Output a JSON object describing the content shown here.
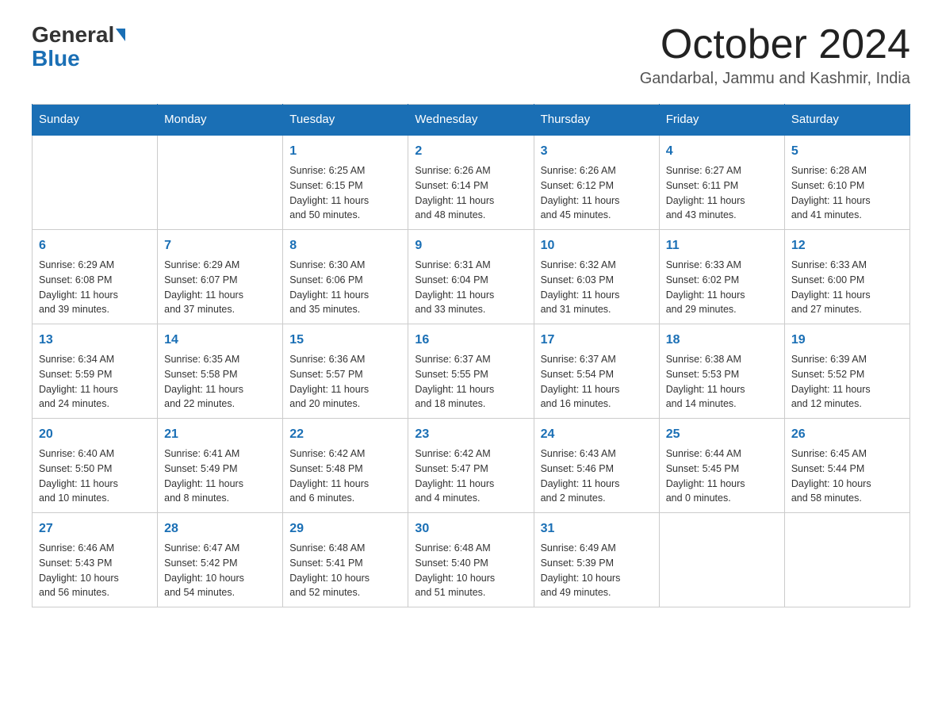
{
  "header": {
    "logo_general": "General",
    "logo_blue": "Blue",
    "month": "October 2024",
    "location": "Gandarbal, Jammu and Kashmir, India"
  },
  "days_of_week": [
    "Sunday",
    "Monday",
    "Tuesday",
    "Wednesday",
    "Thursday",
    "Friday",
    "Saturday"
  ],
  "weeks": [
    [
      {
        "day": "",
        "info": ""
      },
      {
        "day": "",
        "info": ""
      },
      {
        "day": "1",
        "info": "Sunrise: 6:25 AM\nSunset: 6:15 PM\nDaylight: 11 hours\nand 50 minutes."
      },
      {
        "day": "2",
        "info": "Sunrise: 6:26 AM\nSunset: 6:14 PM\nDaylight: 11 hours\nand 48 minutes."
      },
      {
        "day": "3",
        "info": "Sunrise: 6:26 AM\nSunset: 6:12 PM\nDaylight: 11 hours\nand 45 minutes."
      },
      {
        "day": "4",
        "info": "Sunrise: 6:27 AM\nSunset: 6:11 PM\nDaylight: 11 hours\nand 43 minutes."
      },
      {
        "day": "5",
        "info": "Sunrise: 6:28 AM\nSunset: 6:10 PM\nDaylight: 11 hours\nand 41 minutes."
      }
    ],
    [
      {
        "day": "6",
        "info": "Sunrise: 6:29 AM\nSunset: 6:08 PM\nDaylight: 11 hours\nand 39 minutes."
      },
      {
        "day": "7",
        "info": "Sunrise: 6:29 AM\nSunset: 6:07 PM\nDaylight: 11 hours\nand 37 minutes."
      },
      {
        "day": "8",
        "info": "Sunrise: 6:30 AM\nSunset: 6:06 PM\nDaylight: 11 hours\nand 35 minutes."
      },
      {
        "day": "9",
        "info": "Sunrise: 6:31 AM\nSunset: 6:04 PM\nDaylight: 11 hours\nand 33 minutes."
      },
      {
        "day": "10",
        "info": "Sunrise: 6:32 AM\nSunset: 6:03 PM\nDaylight: 11 hours\nand 31 minutes."
      },
      {
        "day": "11",
        "info": "Sunrise: 6:33 AM\nSunset: 6:02 PM\nDaylight: 11 hours\nand 29 minutes."
      },
      {
        "day": "12",
        "info": "Sunrise: 6:33 AM\nSunset: 6:00 PM\nDaylight: 11 hours\nand 27 minutes."
      }
    ],
    [
      {
        "day": "13",
        "info": "Sunrise: 6:34 AM\nSunset: 5:59 PM\nDaylight: 11 hours\nand 24 minutes."
      },
      {
        "day": "14",
        "info": "Sunrise: 6:35 AM\nSunset: 5:58 PM\nDaylight: 11 hours\nand 22 minutes."
      },
      {
        "day": "15",
        "info": "Sunrise: 6:36 AM\nSunset: 5:57 PM\nDaylight: 11 hours\nand 20 minutes."
      },
      {
        "day": "16",
        "info": "Sunrise: 6:37 AM\nSunset: 5:55 PM\nDaylight: 11 hours\nand 18 minutes."
      },
      {
        "day": "17",
        "info": "Sunrise: 6:37 AM\nSunset: 5:54 PM\nDaylight: 11 hours\nand 16 minutes."
      },
      {
        "day": "18",
        "info": "Sunrise: 6:38 AM\nSunset: 5:53 PM\nDaylight: 11 hours\nand 14 minutes."
      },
      {
        "day": "19",
        "info": "Sunrise: 6:39 AM\nSunset: 5:52 PM\nDaylight: 11 hours\nand 12 minutes."
      }
    ],
    [
      {
        "day": "20",
        "info": "Sunrise: 6:40 AM\nSunset: 5:50 PM\nDaylight: 11 hours\nand 10 minutes."
      },
      {
        "day": "21",
        "info": "Sunrise: 6:41 AM\nSunset: 5:49 PM\nDaylight: 11 hours\nand 8 minutes."
      },
      {
        "day": "22",
        "info": "Sunrise: 6:42 AM\nSunset: 5:48 PM\nDaylight: 11 hours\nand 6 minutes."
      },
      {
        "day": "23",
        "info": "Sunrise: 6:42 AM\nSunset: 5:47 PM\nDaylight: 11 hours\nand 4 minutes."
      },
      {
        "day": "24",
        "info": "Sunrise: 6:43 AM\nSunset: 5:46 PM\nDaylight: 11 hours\nand 2 minutes."
      },
      {
        "day": "25",
        "info": "Sunrise: 6:44 AM\nSunset: 5:45 PM\nDaylight: 11 hours\nand 0 minutes."
      },
      {
        "day": "26",
        "info": "Sunrise: 6:45 AM\nSunset: 5:44 PM\nDaylight: 10 hours\nand 58 minutes."
      }
    ],
    [
      {
        "day": "27",
        "info": "Sunrise: 6:46 AM\nSunset: 5:43 PM\nDaylight: 10 hours\nand 56 minutes."
      },
      {
        "day": "28",
        "info": "Sunrise: 6:47 AM\nSunset: 5:42 PM\nDaylight: 10 hours\nand 54 minutes."
      },
      {
        "day": "29",
        "info": "Sunrise: 6:48 AM\nSunset: 5:41 PM\nDaylight: 10 hours\nand 52 minutes."
      },
      {
        "day": "30",
        "info": "Sunrise: 6:48 AM\nSunset: 5:40 PM\nDaylight: 10 hours\nand 51 minutes."
      },
      {
        "day": "31",
        "info": "Sunrise: 6:49 AM\nSunset: 5:39 PM\nDaylight: 10 hours\nand 49 minutes."
      },
      {
        "day": "",
        "info": ""
      },
      {
        "day": "",
        "info": ""
      }
    ]
  ]
}
